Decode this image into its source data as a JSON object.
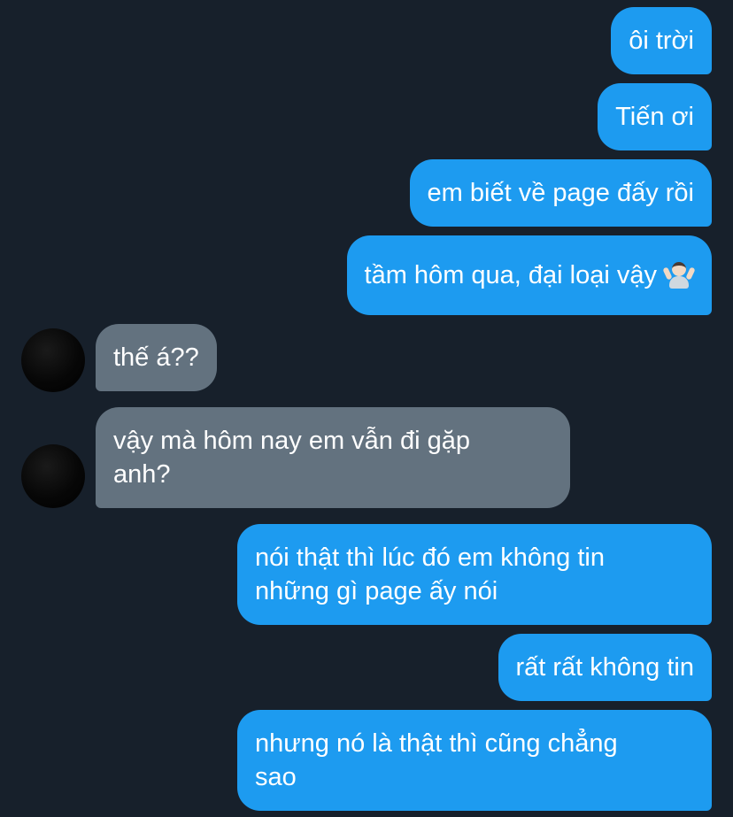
{
  "conversation": {
    "messages": [
      {
        "direction": "outgoing",
        "text": "ôi trời"
      },
      {
        "direction": "outgoing",
        "text": "Tiến ơi"
      },
      {
        "direction": "outgoing",
        "text": "em biết về page đấy rồi"
      },
      {
        "direction": "outgoing",
        "text": "tầm hôm qua, đại loại vậy",
        "emoji": "man-shrugging-emoji"
      },
      {
        "direction": "incoming",
        "text": "thế á??"
      },
      {
        "direction": "incoming",
        "text": "vậy mà hôm nay em vẫn đi gặp\nanh?"
      },
      {
        "direction": "outgoing",
        "text": "nói thật thì lúc đó em không tin\nnhững gì page ấy nói"
      },
      {
        "direction": "outgoing",
        "text": "rất rất không tin"
      },
      {
        "direction": "outgoing",
        "text": "nhưng nó là thật thì cũng chẳng\nsao"
      }
    ]
  },
  "colors": {
    "background": "#17202b",
    "outgoing_bubble": "#1d9bf0",
    "incoming_bubble": "#63727f",
    "text": "#ffffff"
  }
}
